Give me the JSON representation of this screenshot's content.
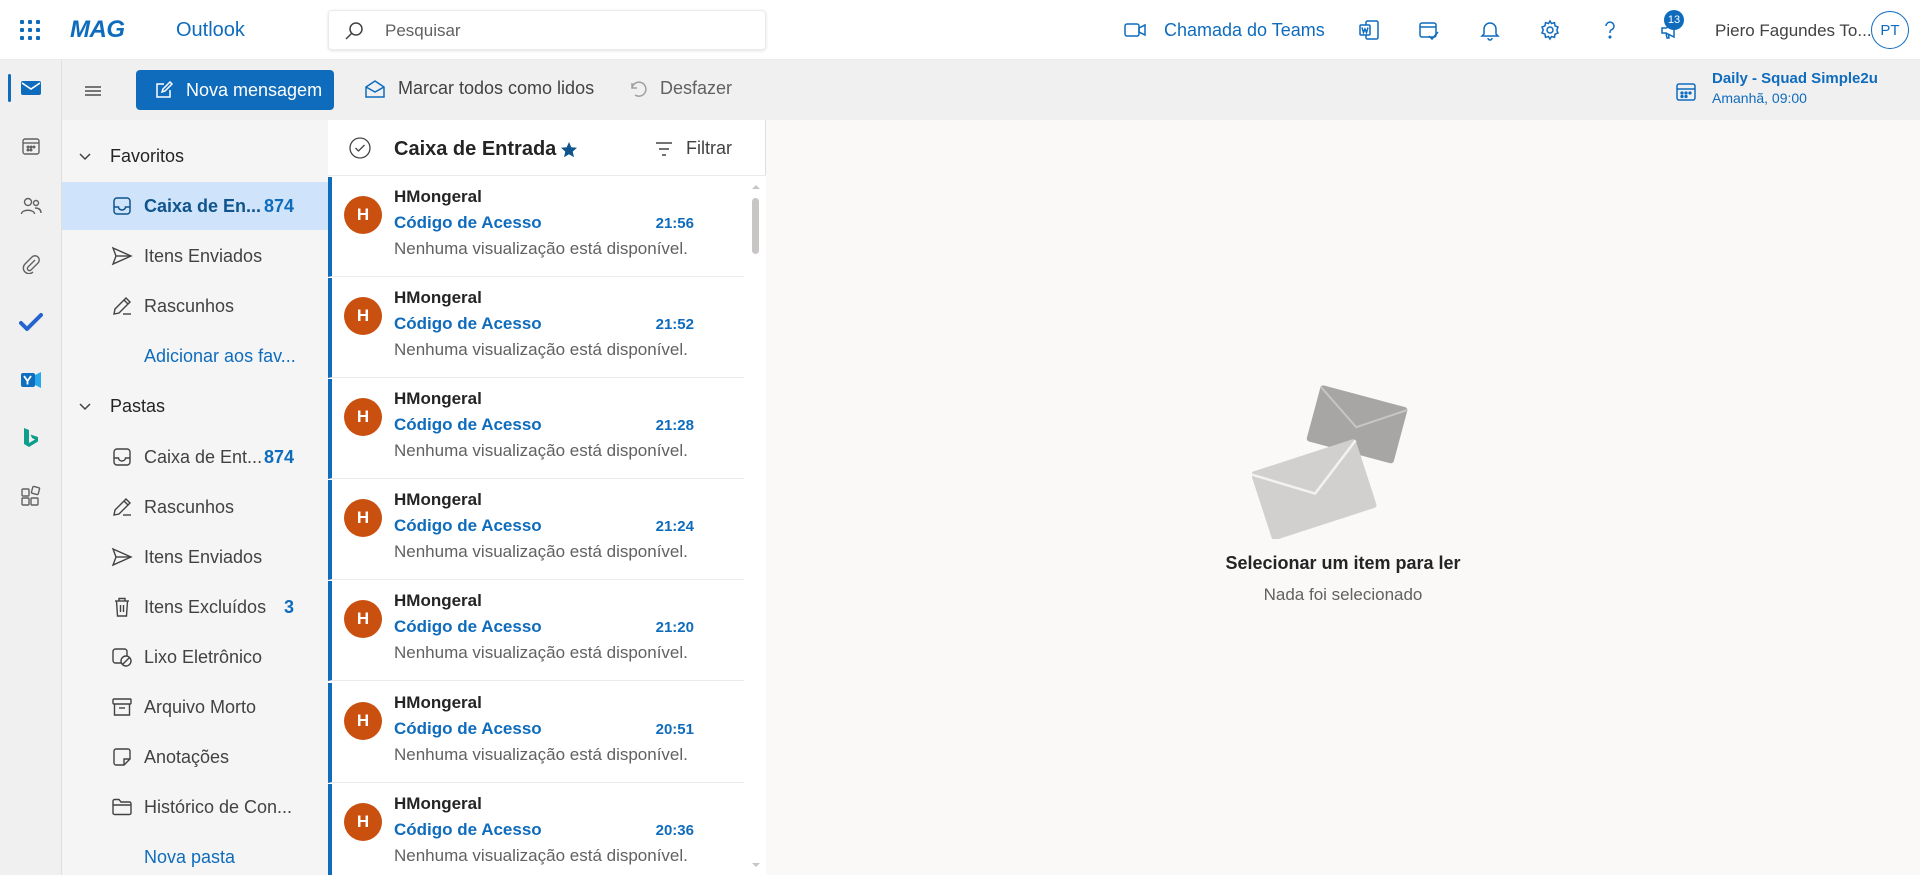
{
  "header": {
    "brand": "MAG",
    "app_name": "Outlook",
    "search_placeholder": "Pesquisar",
    "teams_call_label": "Chamada do Teams",
    "notification_count": "13",
    "user_name": "Piero Fagundes To...",
    "user_initials": "PT"
  },
  "commandbar": {
    "new_message": "Nova mensagem",
    "mark_all_read": "Marcar todos como lidos",
    "undo": "Desfazer",
    "meeting_title": "Daily - Squad Simple2u",
    "meeting_time": "Amanhã, 09:00"
  },
  "folders": {
    "favorites_label": "Favoritos",
    "favorites": [
      {
        "label": "Caixa de En...",
        "count": "874"
      },
      {
        "label": "Itens Enviados",
        "count": ""
      },
      {
        "label": "Rascunhos",
        "count": ""
      }
    ],
    "add_favorite": "Adicionar aos fav...",
    "folders_label": "Pastas",
    "items": [
      {
        "label": "Caixa de Ent...",
        "count": "874"
      },
      {
        "label": "Rascunhos",
        "count": ""
      },
      {
        "label": "Itens Enviados",
        "count": ""
      },
      {
        "label": "Itens Excluídos",
        "count": "3"
      },
      {
        "label": "Lixo Eletrônico",
        "count": ""
      },
      {
        "label": "Arquivo Morto",
        "count": ""
      },
      {
        "label": "Anotações",
        "count": ""
      },
      {
        "label": "Histórico de Con...",
        "count": ""
      }
    ],
    "new_folder": "Nova pasta"
  },
  "list": {
    "title": "Caixa de Entrada",
    "filter": "Filtrar",
    "messages": [
      {
        "initial": "H",
        "sender": "HMongeral",
        "subject": "Código de Acesso",
        "time": "21:56",
        "preview": "Nenhuma visualização está disponível."
      },
      {
        "initial": "H",
        "sender": "HMongeral",
        "subject": "Código de Acesso",
        "time": "21:52",
        "preview": "Nenhuma visualização está disponível."
      },
      {
        "initial": "H",
        "sender": "HMongeral",
        "subject": "Código de Acesso",
        "time": "21:28",
        "preview": "Nenhuma visualização está disponível."
      },
      {
        "initial": "H",
        "sender": "HMongeral",
        "subject": "Código de Acesso",
        "time": "21:24",
        "preview": "Nenhuma visualização está disponível."
      },
      {
        "initial": "H",
        "sender": "HMongeral",
        "subject": "Código de Acesso",
        "time": "21:20",
        "preview": "Nenhuma visualização está disponível."
      },
      {
        "initial": "H",
        "sender": "HMongeral",
        "subject": "Código de Acesso",
        "time": "20:51",
        "preview": "Nenhuma visualização está disponível."
      },
      {
        "initial": "H",
        "sender": "HMongeral",
        "subject": "Código de Acesso",
        "time": "20:36",
        "preview": "Nenhuma visualização está disponível."
      }
    ]
  },
  "reading": {
    "empty_title": "Selecionar um item para ler",
    "empty_subtitle": "Nada foi selecionado"
  },
  "colors": {
    "accent": "#0f6cbd",
    "avatar": "#ca5010",
    "selected_folder": "#cfe4fa"
  }
}
